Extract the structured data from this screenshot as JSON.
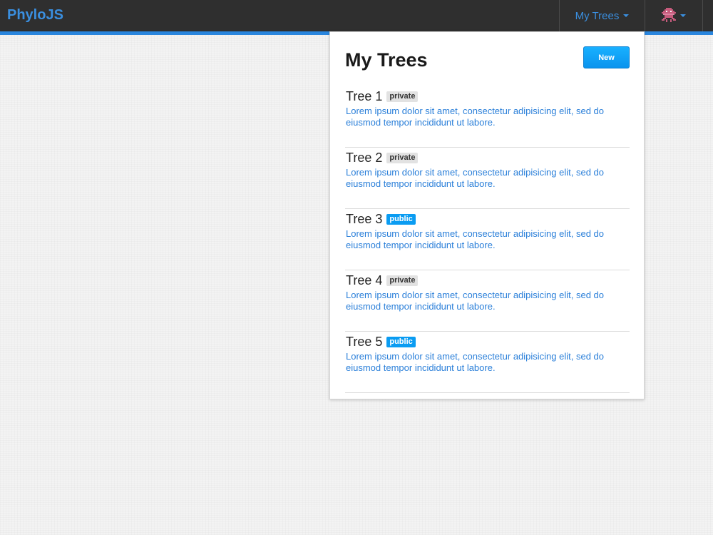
{
  "navbar": {
    "brand": "PhyloJS",
    "trees_menu_label": "My Trees",
    "user_menu_icon": "user-avatar-icon"
  },
  "panel": {
    "title": "My Trees",
    "new_button_label": "New",
    "trees": [
      {
        "name": "Tree 1",
        "visibility": "private",
        "description": "Lorem ipsum dolor sit amet, consectetur adipisicing elit, sed do eiusmod tempor incididunt ut labore."
      },
      {
        "name": "Tree 2",
        "visibility": "private",
        "description": "Lorem ipsum dolor sit amet, consectetur adipisicing elit, sed do eiusmod tempor incididunt ut labore."
      },
      {
        "name": "Tree 3",
        "visibility": "public",
        "description": "Lorem ipsum dolor sit amet, consectetur adipisicing elit, sed do eiusmod tempor incididunt ut labore."
      },
      {
        "name": "Tree 4",
        "visibility": "private",
        "description": "Lorem ipsum dolor sit amet, consectetur adipisicing elit, sed do eiusmod tempor incididunt ut labore."
      },
      {
        "name": "Tree 5",
        "visibility": "public",
        "description": "Lorem ipsum dolor sit amet, consectetur adipisicing elit, sed do eiusmod tempor incididunt ut labore."
      }
    ]
  },
  "colors": {
    "accent": "#2a86de",
    "navbar_bg": "#2f2f2f",
    "public_badge": "#0a9cf2",
    "private_badge": "#e2e2e2"
  }
}
